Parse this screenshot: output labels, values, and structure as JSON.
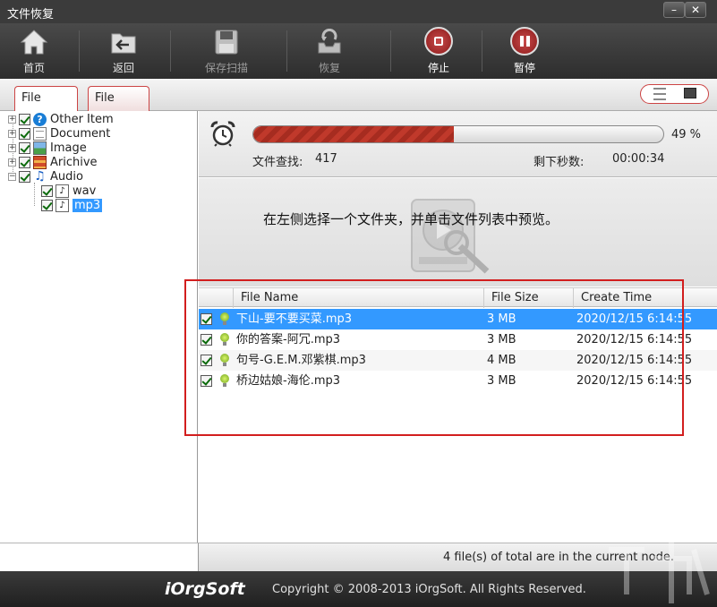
{
  "window": {
    "title": "文件恢复",
    "min_glyph": "–",
    "close_glyph": "✕"
  },
  "toolbar": {
    "home": {
      "label": "首页",
      "icon": "home-icon"
    },
    "back": {
      "label": "返回",
      "icon": "back-folder-icon"
    },
    "save_scan": {
      "label": "保存扫描",
      "icon": "floppy-icon"
    },
    "recover": {
      "label": "恢复",
      "icon": "recover-icon"
    },
    "stop": {
      "label": "停止",
      "icon": "stop-icon"
    },
    "pause": {
      "label": "暂停",
      "icon": "pause-icon"
    }
  },
  "tabs": {
    "file_type": "File Type",
    "file_path": "File Path"
  },
  "tree": {
    "items": [
      {
        "label": "Other Item",
        "icon": "question-icon",
        "checked": true
      },
      {
        "label": "Document",
        "icon": "document-icon",
        "checked": true
      },
      {
        "label": "Image",
        "icon": "image-icon",
        "checked": true
      },
      {
        "label": "Arichive",
        "icon": "archive-icon",
        "checked": true
      },
      {
        "label": "Audio",
        "icon": "music-note-icon",
        "checked": true
      },
      {
        "label": "wav",
        "icon": "audio-file-icon",
        "checked": true
      },
      {
        "label": "mp3",
        "icon": "audio-file-icon",
        "checked": true,
        "selected": true
      }
    ]
  },
  "progress": {
    "percent": 49,
    "percent_text": "49 %",
    "found_label": "文件查找:",
    "found_count": "417",
    "remaining_label": "剩下秒数:",
    "remaining_time": "00:00:34"
  },
  "preview": {
    "message": "在左侧选择一个文件夹，并单击文件列表中预览。"
  },
  "table": {
    "columns": [
      "File Name",
      "File Size",
      "Create Time"
    ],
    "rows": [
      {
        "name": "下山-要不要买菜.mp3",
        "size": "3 MB",
        "time": "2020/12/15 6:14:55",
        "selected": true
      },
      {
        "name": "你的答案-阿冗.mp3",
        "size": "3 MB",
        "time": "2020/12/15 6:14:55"
      },
      {
        "name": "句号-G.E.M.邓紫棋.mp3",
        "size": "4 MB",
        "time": "2020/12/15 6:14:55"
      },
      {
        "name": "桥边姑娘-海伦.mp3",
        "size": "3 MB",
        "time": "2020/12/15 6:14:55"
      }
    ]
  },
  "status": {
    "text": "4 file(s) of total are in the current node."
  },
  "footer": {
    "brand": "iOrgSoft",
    "copyright": "Copyright © 2008-2013 iOrgSoft. All Rights Reserved."
  },
  "colors": {
    "accent": "#c0392b",
    "selection": "#3399ff",
    "toolbar": "#3a3a3a",
    "annotation": "#d21e1e"
  }
}
